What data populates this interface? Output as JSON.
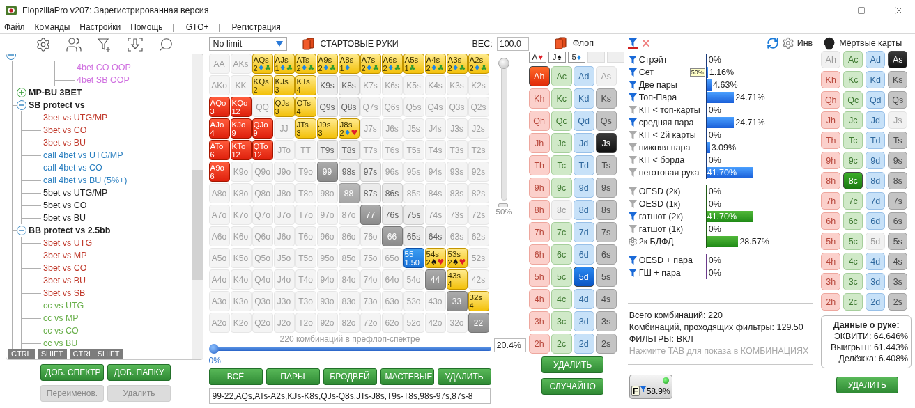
{
  "window": {
    "title": "FlopzillaPro v207: Зарегистрированная версия"
  },
  "menu": [
    {
      "label": "Файл",
      "kind": "item"
    },
    {
      "label": "Команды",
      "kind": "item"
    },
    {
      "label": "Настройки",
      "kind": "item"
    },
    {
      "label": "Помощь",
      "kind": "item"
    },
    {
      "label": "|",
      "kind": "separator"
    },
    {
      "label": "GTO+",
      "kind": "item"
    },
    {
      "label": "|",
      "kind": "separator"
    },
    {
      "label": "Регистрация",
      "kind": "item"
    }
  ],
  "tree": {
    "expanded": true,
    "children": [
      {
        "children": [
          {
            "label": "4bet CO OOP",
            "color": "#d070e0"
          },
          {
            "label": "4bet SB OOP",
            "color": "#d070e0"
          }
        ]
      },
      {
        "label": "MP-BU 3BET",
        "expanded": false
      },
      {
        "label": "SB protect vs",
        "expanded": true,
        "children": [
          {
            "label": "3bet vs UTG/MP",
            "color": "#c0392b"
          },
          {
            "label": "3bet vs CO",
            "color": "#c0392b"
          },
          {
            "label": "3bet vs BU",
            "color": "#c0392b"
          },
          {
            "label": "call 4bet vs UTG/MP",
            "color": "#2a7fc0"
          },
          {
            "label": "call 4bet vs CO",
            "color": "#2a7fc0"
          },
          {
            "label": "call 4bet vs BU (5%+)",
            "color": "#2a7fc0"
          },
          {
            "label": "5bet vs UTG/MP",
            "color": "#222222"
          },
          {
            "label": "5bet vs CO",
            "color": "#222222"
          },
          {
            "label": "5bet vs BU",
            "color": "#222222"
          }
        ]
      },
      {
        "label": "BB protect vs 2.5bb",
        "expanded": true,
        "children": [
          {
            "label": "3bet vs UTG",
            "color": "#c0392b"
          },
          {
            "label": "3bet vs MP",
            "color": "#c0392b"
          },
          {
            "label": "3bet vs CO",
            "color": "#c0392b"
          },
          {
            "label": "3bet vs BU",
            "color": "#c0392b"
          },
          {
            "label": "3bet vs SB",
            "color": "#c0392b"
          },
          {
            "label": "cc vs UTG",
            "color": "#6ab04c"
          },
          {
            "label": "cc vs MP",
            "color": "#6ab04c"
          },
          {
            "label": "cc vs CO",
            "color": "#6ab04c"
          },
          {
            "label": "cc vs BU",
            "color": "#6ab04c"
          }
        ]
      }
    ]
  },
  "modifier_keys": [
    "CTRL",
    "SHIFT",
    "CTRL+SHIFT"
  ],
  "tree_buttons": [
    {
      "label": "ДОБ. СПЕКТР",
      "disabled": false
    },
    {
      "label": "ДОБ. ПАПКУ",
      "disabled": false
    },
    {
      "label": "Переименов.",
      "disabled": true
    },
    {
      "label": "Удалить",
      "disabled": true
    }
  ],
  "game_select": {
    "value": "No limit"
  },
  "range_title": "СТАРТОВЫЕ РУКИ",
  "weight": {
    "label": "ВЕС:",
    "value": "100.0",
    "level": 1,
    "marker": "50%"
  },
  "matrix": {
    "rows": [
      {
        "cells": [
          {
            "label": "AA",
            "kind": "off"
          },
          {
            "label": "AKs",
            "kind": "off"
          },
          {
            "label": "AQs",
            "kind": "yellow",
            "count": "2",
            "suits": [
              {
                "symbol": "♦",
                "color": "#1e88e5"
              },
              {
                "symbol": "♣",
                "color": "#2e9a2e"
              }
            ]
          },
          {
            "label": "AJs",
            "kind": "yellow",
            "count": "1",
            "suits": [
              {
                "symbol": "♦",
                "color": "#1e88e5"
              },
              {
                "symbol": "♣",
                "color": "#2e9a2e"
              }
            ]
          },
          {
            "label": "ATs",
            "kind": "yellow",
            "count": "2",
            "suits": [
              {
                "symbol": "♦",
                "color": "#1e88e5"
              },
              {
                "symbol": "♣",
                "color": "#2e9a2e"
              }
            ]
          },
          {
            "label": "A9s",
            "kind": "yellow",
            "count": "2",
            "suits": [
              {
                "symbol": "♦",
                "color": "#1e88e5"
              },
              {
                "symbol": "♣",
                "color": "#2e9a2e"
              }
            ]
          },
          {
            "label": "A8s",
            "kind": "yellow",
            "count": "1",
            "suits": [
              {
                "symbol": "♦",
                "color": "#1e88e5"
              }
            ]
          },
          {
            "label": "A7s",
            "kind": "yellow",
            "count": "2",
            "suits": [
              {
                "symbol": "♦",
                "color": "#1e88e5"
              },
              {
                "symbol": "♣",
                "color": "#2e9a2e"
              }
            ]
          },
          {
            "label": "A6s",
            "kind": "yellow",
            "count": "2",
            "suits": [
              {
                "symbol": "♦",
                "color": "#1e88e5"
              },
              {
                "symbol": "♣",
                "color": "#2e9a2e"
              }
            ]
          },
          {
            "label": "A5s",
            "kind": "yellow",
            "count": "1",
            "suits": [
              {
                "symbol": "♣",
                "color": "#2e9a2e"
              }
            ]
          },
          {
            "label": "A4s",
            "kind": "yellow",
            "count": "2",
            "suits": [
              {
                "symbol": "♦",
                "color": "#1e88e5"
              },
              {
                "symbol": "♣",
                "color": "#2e9a2e"
              }
            ]
          },
          {
            "label": "A3s",
            "kind": "yellow",
            "count": "2",
            "suits": [
              {
                "symbol": "♦",
                "color": "#1e88e5"
              },
              {
                "symbol": "♣",
                "color": "#2e9a2e"
              }
            ]
          },
          {
            "label": "A2s",
            "kind": "yellow",
            "count": "2",
            "suits": [
              {
                "symbol": "♦",
                "color": "#1e88e5"
              },
              {
                "symbol": "♣",
                "color": "#2e9a2e"
              }
            ]
          }
        ]
      },
      {
        "cells": [
          {
            "label": "AKo",
            "kind": "off"
          },
          {
            "label": "KK",
            "kind": "off"
          },
          {
            "label": "KQs",
            "kind": "yellow",
            "count": "2"
          },
          {
            "label": "KJs",
            "kind": "yellow",
            "count": "3"
          },
          {
            "label": "KTs",
            "kind": "yellow",
            "count": "4"
          },
          {
            "label": "K9s",
            "kind": "plain"
          },
          {
            "label": "K8s",
            "kind": "plain"
          },
          {
            "label": "K7s",
            "kind": "off"
          },
          {
            "label": "K6s",
            "kind": "off"
          },
          {
            "label": "K5s",
            "kind": "off"
          },
          {
            "label": "K4s",
            "kind": "off"
          },
          {
            "label": "K3s",
            "kind": "off"
          },
          {
            "label": "K2s",
            "kind": "off"
          }
        ]
      },
      {
        "cells": [
          {
            "label": "AQo",
            "kind": "red",
            "count": "3"
          },
          {
            "label": "KQo",
            "kind": "red",
            "count": "12"
          },
          {
            "label": "QQ",
            "kind": "off"
          },
          {
            "label": "QJs",
            "kind": "yellow",
            "count": "3"
          },
          {
            "label": "QTs",
            "kind": "yellow",
            "count": "4"
          },
          {
            "label": "Q9s",
            "kind": "plain"
          },
          {
            "label": "Q8s",
            "kind": "plain"
          },
          {
            "label": "Q7s",
            "kind": "off"
          },
          {
            "label": "Q6s",
            "kind": "off"
          },
          {
            "label": "Q5s",
            "kind": "off"
          },
          {
            "label": "Q4s",
            "kind": "off"
          },
          {
            "label": "Q3s",
            "kind": "off"
          },
          {
            "label": "Q2s",
            "kind": "off"
          }
        ]
      },
      {
        "cells": [
          {
            "label": "AJo",
            "kind": "red",
            "count": "4"
          },
          {
            "label": "KJo",
            "kind": "red",
            "count": "9"
          },
          {
            "label": "QJo",
            "kind": "red",
            "count": "9"
          },
          {
            "label": "JJ",
            "kind": "off"
          },
          {
            "label": "JTs",
            "kind": "yellow",
            "count": "3"
          },
          {
            "label": "J9s",
            "kind": "yellow",
            "count": "3"
          },
          {
            "label": "J8s",
            "kind": "yellow",
            "count": "2",
            "suits": [
              {
                "symbol": "♦",
                "color": "#1e88e5"
              },
              {
                "symbol": "♥",
                "color": "#e0202a"
              }
            ]
          },
          {
            "label": "J7s",
            "kind": "off"
          },
          {
            "label": "J6s",
            "kind": "off"
          },
          {
            "label": "J5s",
            "kind": "off"
          },
          {
            "label": "J4s",
            "kind": "off"
          },
          {
            "label": "J3s",
            "kind": "off"
          },
          {
            "label": "J2s",
            "kind": "off"
          }
        ]
      },
      {
        "cells": [
          {
            "label": "ATo",
            "kind": "red",
            "count": "6"
          },
          {
            "label": "KTo",
            "kind": "red",
            "count": "12"
          },
          {
            "label": "QTo",
            "kind": "red",
            "count": "12"
          },
          {
            "label": "JTo",
            "kind": "off"
          },
          {
            "label": "TT",
            "kind": "off"
          },
          {
            "label": "T9s",
            "kind": "plain"
          },
          {
            "label": "T8s",
            "kind": "plain"
          },
          {
            "label": "T7s",
            "kind": "off"
          },
          {
            "label": "T6s",
            "kind": "off"
          },
          {
            "label": "T5s",
            "kind": "off"
          },
          {
            "label": "T4s",
            "kind": "off"
          },
          {
            "label": "T3s",
            "kind": "off"
          },
          {
            "label": "T2s",
            "kind": "off"
          }
        ]
      },
      {
        "cells": [
          {
            "label": "A9o",
            "kind": "red",
            "count": "6"
          },
          {
            "label": "K9o",
            "kind": "off"
          },
          {
            "label": "Q9o",
            "kind": "off"
          },
          {
            "label": "J9o",
            "kind": "off"
          },
          {
            "label": "T9o",
            "kind": "off"
          },
          {
            "label": "99",
            "kind": "pair"
          },
          {
            "label": "98s",
            "kind": "plain"
          },
          {
            "label": "97s",
            "kind": "plain"
          },
          {
            "label": "96s",
            "kind": "off"
          },
          {
            "label": "95s",
            "kind": "off"
          },
          {
            "label": "94s",
            "kind": "off"
          },
          {
            "label": "93s",
            "kind": "off"
          },
          {
            "label": "92s",
            "kind": "off"
          }
        ]
      },
      {
        "cells": [
          {
            "label": "A8o",
            "kind": "off"
          },
          {
            "label": "K8o",
            "kind": "off"
          },
          {
            "label": "Q8o",
            "kind": "off"
          },
          {
            "label": "J8o",
            "kind": "off"
          },
          {
            "label": "T8o",
            "kind": "off"
          },
          {
            "label": "98o",
            "kind": "off"
          },
          {
            "label": "88",
            "kind": "pair-light"
          },
          {
            "label": "87s",
            "kind": "plain"
          },
          {
            "label": "86s",
            "kind": "plain"
          },
          {
            "label": "85s",
            "kind": "off"
          },
          {
            "label": "84s",
            "kind": "off"
          },
          {
            "label": "83s",
            "kind": "off"
          },
          {
            "label": "82s",
            "kind": "off"
          }
        ]
      },
      {
        "cells": [
          {
            "label": "A7o",
            "kind": "off"
          },
          {
            "label": "K7o",
            "kind": "off"
          },
          {
            "label": "Q7o",
            "kind": "off"
          },
          {
            "label": "J7o",
            "kind": "off"
          },
          {
            "label": "T7o",
            "kind": "off"
          },
          {
            "label": "97o",
            "kind": "off"
          },
          {
            "label": "87o",
            "kind": "off"
          },
          {
            "label": "77",
            "kind": "pair"
          },
          {
            "label": "76s",
            "kind": "plain"
          },
          {
            "label": "75s",
            "kind": "plain"
          },
          {
            "label": "74s",
            "kind": "off"
          },
          {
            "label": "73s",
            "kind": "off"
          },
          {
            "label": "72s",
            "kind": "off"
          }
        ]
      },
      {
        "cells": [
          {
            "label": "A6o",
            "kind": "off"
          },
          {
            "label": "K6o",
            "kind": "off"
          },
          {
            "label": "Q6o",
            "kind": "off"
          },
          {
            "label": "J6o",
            "kind": "off"
          },
          {
            "label": "T6o",
            "kind": "off"
          },
          {
            "label": "96o",
            "kind": "off"
          },
          {
            "label": "86o",
            "kind": "off"
          },
          {
            "label": "76o",
            "kind": "off"
          },
          {
            "label": "66",
            "kind": "pair"
          },
          {
            "label": "65s",
            "kind": "plain"
          },
          {
            "label": "64s",
            "kind": "plain"
          },
          {
            "label": "63s",
            "kind": "off"
          },
          {
            "label": "62s",
            "kind": "off"
          }
        ]
      },
      {
        "cells": [
          {
            "label": "A5o",
            "kind": "off"
          },
          {
            "label": "K5o",
            "kind": "off"
          },
          {
            "label": "Q5o",
            "kind": "off"
          },
          {
            "label": "J5o",
            "kind": "off"
          },
          {
            "label": "T5o",
            "kind": "off"
          },
          {
            "label": "95o",
            "kind": "off"
          },
          {
            "label": "85o",
            "kind": "off"
          },
          {
            "label": "75o",
            "kind": "off"
          },
          {
            "label": "65o",
            "kind": "off"
          },
          {
            "label": "55",
            "kind": "blue",
            "count": "1.50"
          },
          {
            "label": "54s",
            "kind": "yellow",
            "count": "2",
            "suits": [
              {
                "symbol": "♠",
                "color": "#111111"
              },
              {
                "symbol": "♥",
                "color": "#e0202a"
              }
            ]
          },
          {
            "label": "53s",
            "kind": "yellow",
            "count": "2",
            "suits": [
              {
                "symbol": "♠",
                "color": "#111111"
              },
              {
                "symbol": "♥",
                "color": "#e0202a"
              }
            ]
          },
          {
            "label": "52s",
            "kind": "off"
          }
        ]
      },
      {
        "cells": [
          {
            "label": "A4o",
            "kind": "off"
          },
          {
            "label": "K4o",
            "kind": "off"
          },
          {
            "label": "Q4o",
            "kind": "off"
          },
          {
            "label": "J4o",
            "kind": "off"
          },
          {
            "label": "T4o",
            "kind": "off"
          },
          {
            "label": "94o",
            "kind": "off"
          },
          {
            "label": "84o",
            "kind": "off"
          },
          {
            "label": "74o",
            "kind": "off"
          },
          {
            "label": "64o",
            "kind": "off"
          },
          {
            "label": "54o",
            "kind": "off"
          },
          {
            "label": "44",
            "kind": "pair"
          },
          {
            "label": "43s",
            "kind": "yellow",
            "count": "4"
          },
          {
            "label": "42s",
            "kind": "off"
          }
        ]
      },
      {
        "cells": [
          {
            "label": "A3o",
            "kind": "off"
          },
          {
            "label": "K3o",
            "kind": "off"
          },
          {
            "label": "Q3o",
            "kind": "off"
          },
          {
            "label": "J3o",
            "kind": "off"
          },
          {
            "label": "T3o",
            "kind": "off"
          },
          {
            "label": "93o",
            "kind": "off"
          },
          {
            "label": "83o",
            "kind": "off"
          },
          {
            "label": "73o",
            "kind": "off"
          },
          {
            "label": "63o",
            "kind": "off"
          },
          {
            "label": "53o",
            "kind": "off"
          },
          {
            "label": "43o",
            "kind": "off"
          },
          {
            "label": "33",
            "kind": "pair"
          },
          {
            "label": "32s",
            "kind": "yellow",
            "count": "4"
          }
        ]
      },
      {
        "cells": [
          {
            "label": "A2o",
            "kind": "off"
          },
          {
            "label": "K2o",
            "kind": "off"
          },
          {
            "label": "Q2o",
            "kind": "off"
          },
          {
            "label": "J2o",
            "kind": "off"
          },
          {
            "label": "T2o",
            "kind": "off"
          },
          {
            "label": "92o",
            "kind": "off"
          },
          {
            "label": "82o",
            "kind": "off"
          },
          {
            "label": "72o",
            "kind": "off"
          },
          {
            "label": "62o",
            "kind": "off"
          },
          {
            "label": "52o",
            "kind": "off"
          },
          {
            "label": "42o",
            "kind": "off"
          },
          {
            "label": "32o",
            "kind": "off"
          },
          {
            "label": "22",
            "kind": "pair"
          }
        ]
      }
    ]
  },
  "matrix_caption": "220 комбинаций в префлоп-спектре",
  "range_slider": {
    "level": 0,
    "label": "0%",
    "value": "20.4%"
  },
  "range_buttons": [
    "ВСЁ",
    "ПАРЫ",
    "БРОДВЕЙ",
    "МАСТЕВЫЕ",
    "УДАЛИТЬ"
  ],
  "range_text": {
    "value": "99-22,AQs,ATs-A2s,KJs-K8s,QJs-Q8s,JTs-J8s,T9s-T8s,98s-97s,87s-8"
  },
  "flop": {
    "title": "Флоп",
    "slots": [
      {
        "kind": "card",
        "rank": "A",
        "suit": "♥",
        "color": "#e0202a"
      },
      {
        "kind": "card",
        "rank": "J",
        "suit": "♠",
        "color": "#111111"
      },
      {
        "kind": "card",
        "rank": "5",
        "suit": "♦",
        "color": "#1e88e5"
      },
      {
        "kind": "empty"
      },
      {
        "kind": "empty"
      }
    ],
    "deck": [
      {
        "label": "Ah",
        "kind": "hearts",
        "selected": true,
        "disabled": false
      },
      {
        "label": "Ac",
        "kind": "clubs",
        "selected": false,
        "disabled": false
      },
      {
        "label": "Ad",
        "kind": "diamonds",
        "selected": false,
        "disabled": false
      },
      {
        "label": "As",
        "kind": "spades",
        "selected": false,
        "disabled": true
      },
      {
        "label": "Kh",
        "kind": "hearts",
        "selected": false,
        "disabled": false
      },
      {
        "label": "Kc",
        "kind": "clubs",
        "selected": false,
        "disabled": false
      },
      {
        "label": "Kd",
        "kind": "diamonds",
        "selected": false,
        "disabled": false
      },
      {
        "label": "Ks",
        "kind": "spades",
        "selected": false,
        "disabled": false
      },
      {
        "label": "Qh",
        "kind": "hearts",
        "selected": false,
        "disabled": false
      },
      {
        "label": "Qc",
        "kind": "clubs",
        "selected": false,
        "disabled": false
      },
      {
        "label": "Qd",
        "kind": "diamonds",
        "selected": false,
        "disabled": false
      },
      {
        "label": "Qs",
        "kind": "spades",
        "selected": false,
        "disabled": false
      },
      {
        "label": "Jh",
        "kind": "hearts",
        "selected": false,
        "disabled": false
      },
      {
        "label": "Jc",
        "kind": "clubs",
        "selected": false,
        "disabled": false
      },
      {
        "label": "Jd",
        "kind": "diamonds",
        "selected": false,
        "disabled": false
      },
      {
        "label": "Js",
        "kind": "spades",
        "selected": true,
        "disabled": false
      },
      {
        "label": "Th",
        "kind": "hearts",
        "selected": false,
        "disabled": false
      },
      {
        "label": "Tc",
        "kind": "clubs",
        "selected": false,
        "disabled": false
      },
      {
        "label": "Td",
        "kind": "diamonds",
        "selected": false,
        "disabled": false
      },
      {
        "label": "Ts",
        "kind": "spades",
        "selected": false,
        "disabled": false
      },
      {
        "label": "9h",
        "kind": "hearts",
        "selected": false,
        "disabled": false
      },
      {
        "label": "9c",
        "kind": "clubs",
        "selected": false,
        "disabled": false
      },
      {
        "label": "9d",
        "kind": "diamonds",
        "selected": false,
        "disabled": false
      },
      {
        "label": "9s",
        "kind": "spades",
        "selected": false,
        "disabled": false
      },
      {
        "label": "8h",
        "kind": "hearts",
        "selected": false,
        "disabled": false
      },
      {
        "label": "8c",
        "kind": "clubs",
        "selected": false,
        "disabled": true
      },
      {
        "label": "8d",
        "kind": "diamonds",
        "selected": false,
        "disabled": false
      },
      {
        "label": "8s",
        "kind": "spades",
        "selected": false,
        "disabled": false
      },
      {
        "label": "7h",
        "kind": "hearts",
        "selected": false,
        "disabled": false
      },
      {
        "label": "7c",
        "kind": "clubs",
        "selected": false,
        "disabled": false
      },
      {
        "label": "7d",
        "kind": "diamonds",
        "selected": false,
        "disabled": false
      },
      {
        "label": "7s",
        "kind": "spades",
        "selected": false,
        "disabled": false
      },
      {
        "label": "6h",
        "kind": "hearts",
        "selected": false,
        "disabled": false
      },
      {
        "label": "6c",
        "kind": "clubs",
        "selected": false,
        "disabled": false
      },
      {
        "label": "6d",
        "kind": "diamonds",
        "selected": false,
        "disabled": false
      },
      {
        "label": "6s",
        "kind": "spades",
        "selected": false,
        "disabled": false
      },
      {
        "label": "5h",
        "kind": "hearts",
        "selected": false,
        "disabled": false
      },
      {
        "label": "5c",
        "kind": "clubs",
        "selected": false,
        "disabled": false
      },
      {
        "label": "5d",
        "kind": "diamonds",
        "selected": true,
        "disabled": false
      },
      {
        "label": "5s",
        "kind": "spades",
        "selected": false,
        "disabled": false
      },
      {
        "label": "4h",
        "kind": "hearts",
        "selected": false,
        "disabled": false
      },
      {
        "label": "4c",
        "kind": "clubs",
        "selected": false,
        "disabled": false
      },
      {
        "label": "4d",
        "kind": "diamonds",
        "selected": false,
        "disabled": false
      },
      {
        "label": "4s",
        "kind": "spades",
        "selected": false,
        "disabled": false
      },
      {
        "label": "3h",
        "kind": "hearts",
        "selected": false,
        "disabled": false
      },
      {
        "label": "3c",
        "kind": "clubs",
        "selected": false,
        "disabled": false
      },
      {
        "label": "3d",
        "kind": "diamonds",
        "selected": false,
        "disabled": false
      },
      {
        "label": "3s",
        "kind": "spades",
        "selected": false,
        "disabled": false
      },
      {
        "label": "2h",
        "kind": "hearts",
        "selected": false,
        "disabled": false
      },
      {
        "label": "2c",
        "kind": "clubs",
        "selected": false,
        "disabled": false
      },
      {
        "label": "2d",
        "kind": "diamonds",
        "selected": false,
        "disabled": false
      },
      {
        "label": "2s",
        "kind": "spades",
        "selected": false,
        "disabled": false
      }
    ],
    "buttons": [
      "УДАЛИТЬ",
      "СЛУЧАЙНО"
    ]
  },
  "filters": {
    "invert_label": "Инв",
    "groups": [
      {
        "kind": "made",
        "items": [
          {
            "label": "Стрэйт",
            "kind": "active",
            "level": 0,
            "value": "0%"
          },
          {
            "label": "Сет",
            "kind": "active",
            "level": 0.0116,
            "value": "1.16%",
            "badge": "50%"
          },
          {
            "label": "Две пары",
            "kind": "active",
            "level": 0.0463,
            "value": "4.63%"
          },
          {
            "label": "Топ-Пара",
            "kind": "active",
            "level": 0.2471,
            "value": "24.71%"
          },
          {
            "label": "КП < топ-карты",
            "kind": "inactive",
            "level": 0,
            "value": "0%"
          },
          {
            "label": "средняя пара",
            "kind": "active",
            "level": 0.2471,
            "value": "24.71%"
          },
          {
            "label": "КП < 2й карты",
            "kind": "inactive",
            "level": 0,
            "value": "0%"
          },
          {
            "label": "нижняя пара",
            "kind": "inactive",
            "level": 0.0309,
            "value": "3.09%"
          },
          {
            "label": "КП < борда",
            "kind": "inactive",
            "level": 0,
            "value": "0%"
          },
          {
            "label": "неготовая рука",
            "kind": "inactive",
            "level": 0.417,
            "value": "41.70%"
          }
        ]
      },
      {
        "kind": "draw",
        "items": [
          {
            "label": "OESD (2к)",
            "kind": "inactive",
            "level": 0,
            "value": "0%"
          },
          {
            "label": "OESD (1к)",
            "kind": "inactive",
            "level": 0,
            "value": "0%"
          },
          {
            "label": "гатшот (2к)",
            "kind": "active",
            "level": 0.417,
            "value": "41.70%"
          },
          {
            "label": "гатшот (1к)",
            "kind": "inactive",
            "level": 0,
            "value": "0%"
          },
          {
            "label": "2к БДФД",
            "kind": "settings",
            "level": 0.2857,
            "value": "28.57%"
          }
        ]
      },
      {
        "kind": "combo",
        "items": [
          {
            "label": "OESD + пара",
            "kind": "active",
            "level": 0,
            "value": "0%"
          },
          {
            "label": "ГШ + пара",
            "kind": "active",
            "level": 0,
            "value": "0%"
          }
        ]
      }
    ]
  },
  "stats": {
    "total": "Всего комбинаций: 220",
    "passing": "Комбинаций, проходящих фильтры: 129.50",
    "filters_label": "ФИЛЬТРЫ:",
    "filters_value": "ВКЛ",
    "hint": "Нажмите TAB для показа в КОМБИНАЦИЯХ"
  },
  "filter_badge": {
    "letter": "F",
    "value": "58.9%"
  },
  "dead_cards": {
    "title": "Мёртвые карты",
    "deck": [
      {
        "label": "Ah",
        "kind": "hearts",
        "selected": false,
        "disabled": true
      },
      {
        "label": "Ac",
        "kind": "clubs",
        "selected": false,
        "disabled": false
      },
      {
        "label": "Ad",
        "kind": "diamonds",
        "selected": false,
        "disabled": false
      },
      {
        "label": "As",
        "kind": "spades",
        "selected": true,
        "disabled": false
      },
      {
        "label": "Kh",
        "kind": "hearts",
        "selected": false,
        "disabled": false
      },
      {
        "label": "Kc",
        "kind": "clubs",
        "selected": false,
        "disabled": false
      },
      {
        "label": "Kd",
        "kind": "diamonds",
        "selected": false,
        "disabled": false
      },
      {
        "label": "Ks",
        "kind": "spades",
        "selected": false,
        "disabled": false
      },
      {
        "label": "Qh",
        "kind": "hearts",
        "selected": false,
        "disabled": false
      },
      {
        "label": "Qc",
        "kind": "clubs",
        "selected": false,
        "disabled": false
      },
      {
        "label": "Qd",
        "kind": "diamonds",
        "selected": false,
        "disabled": false
      },
      {
        "label": "Qs",
        "kind": "spades",
        "selected": false,
        "disabled": false
      },
      {
        "label": "Jh",
        "kind": "hearts",
        "selected": false,
        "disabled": false
      },
      {
        "label": "Jc",
        "kind": "clubs",
        "selected": false,
        "disabled": false
      },
      {
        "label": "Jd",
        "kind": "diamonds",
        "selected": false,
        "disabled": false
      },
      {
        "label": "Js",
        "kind": "spades",
        "selected": false,
        "disabled": true
      },
      {
        "label": "Th",
        "kind": "hearts",
        "selected": false,
        "disabled": false
      },
      {
        "label": "Tc",
        "kind": "clubs",
        "selected": false,
        "disabled": false
      },
      {
        "label": "Td",
        "kind": "diamonds",
        "selected": false,
        "disabled": false
      },
      {
        "label": "Ts",
        "kind": "spades",
        "selected": false,
        "disabled": false
      },
      {
        "label": "9h",
        "kind": "hearts",
        "selected": false,
        "disabled": false
      },
      {
        "label": "9c",
        "kind": "clubs",
        "selected": false,
        "disabled": false
      },
      {
        "label": "9d",
        "kind": "diamonds",
        "selected": false,
        "disabled": false
      },
      {
        "label": "9s",
        "kind": "spades",
        "selected": false,
        "disabled": false
      },
      {
        "label": "8h",
        "kind": "hearts",
        "selected": false,
        "disabled": false
      },
      {
        "label": "8c",
        "kind": "clubs",
        "selected": true,
        "disabled": false
      },
      {
        "label": "8d",
        "kind": "diamonds",
        "selected": false,
        "disabled": false
      },
      {
        "label": "8s",
        "kind": "spades",
        "selected": false,
        "disabled": false
      },
      {
        "label": "7h",
        "kind": "hearts",
        "selected": false,
        "disabled": false
      },
      {
        "label": "7c",
        "kind": "clubs",
        "selected": false,
        "disabled": false
      },
      {
        "label": "7d",
        "kind": "diamonds",
        "selected": false,
        "disabled": false
      },
      {
        "label": "7s",
        "kind": "spades",
        "selected": false,
        "disabled": false
      },
      {
        "label": "6h",
        "kind": "hearts",
        "selected": false,
        "disabled": false
      },
      {
        "label": "6c",
        "kind": "clubs",
        "selected": false,
        "disabled": false
      },
      {
        "label": "6d",
        "kind": "diamonds",
        "selected": false,
        "disabled": false
      },
      {
        "label": "6s",
        "kind": "spades",
        "selected": false,
        "disabled": false
      },
      {
        "label": "5h",
        "kind": "hearts",
        "selected": false,
        "disabled": false
      },
      {
        "label": "5c",
        "kind": "clubs",
        "selected": false,
        "disabled": false
      },
      {
        "label": "5d",
        "kind": "diamonds",
        "selected": false,
        "disabled": true
      },
      {
        "label": "5s",
        "kind": "spades",
        "selected": false,
        "disabled": false
      },
      {
        "label": "4h",
        "kind": "hearts",
        "selected": false,
        "disabled": false
      },
      {
        "label": "4c",
        "kind": "clubs",
        "selected": false,
        "disabled": false
      },
      {
        "label": "4d",
        "kind": "diamonds",
        "selected": false,
        "disabled": false
      },
      {
        "label": "4s",
        "kind": "spades",
        "selected": false,
        "disabled": false
      },
      {
        "label": "3h",
        "kind": "hearts",
        "selected": false,
        "disabled": false
      },
      {
        "label": "3c",
        "kind": "clubs",
        "selected": false,
        "disabled": false
      },
      {
        "label": "3d",
        "kind": "diamonds",
        "selected": false,
        "disabled": false
      },
      {
        "label": "3s",
        "kind": "spades",
        "selected": false,
        "disabled": false
      },
      {
        "label": "2h",
        "kind": "hearts",
        "selected": false,
        "disabled": false
      },
      {
        "label": "2c",
        "kind": "clubs",
        "selected": false,
        "disabled": false
      },
      {
        "label": "2d",
        "kind": "diamonds",
        "selected": false,
        "disabled": false
      },
      {
        "label": "2s",
        "kind": "spades",
        "selected": false,
        "disabled": false
      }
    ]
  },
  "hand_data": {
    "title": "Данные о руке:",
    "lines": [
      "ЭКВИТИ: 64.646%",
      "Выигрыш: 61.443%",
      "Делёжка: 6.408%"
    ],
    "button": "УДАЛИТЬ"
  }
}
